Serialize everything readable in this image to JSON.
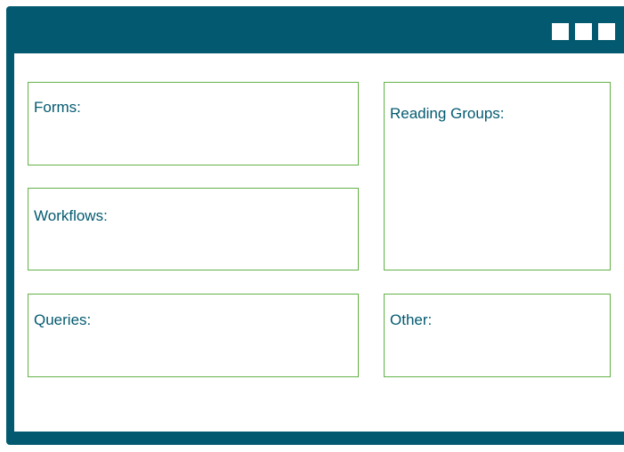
{
  "window": {
    "colors": {
      "frame": "#035a70",
      "panel_border": "#62b246",
      "text": "#035a70",
      "content_bg": "#ffffff"
    },
    "controls": [
      "window-square-icon",
      "window-square-icon",
      "window-square-icon"
    ]
  },
  "panels": {
    "forms": "Forms:",
    "workflows": "Workflows:",
    "queries": "Queries:",
    "reading_groups": "Reading Groups:",
    "other": "Other:"
  }
}
